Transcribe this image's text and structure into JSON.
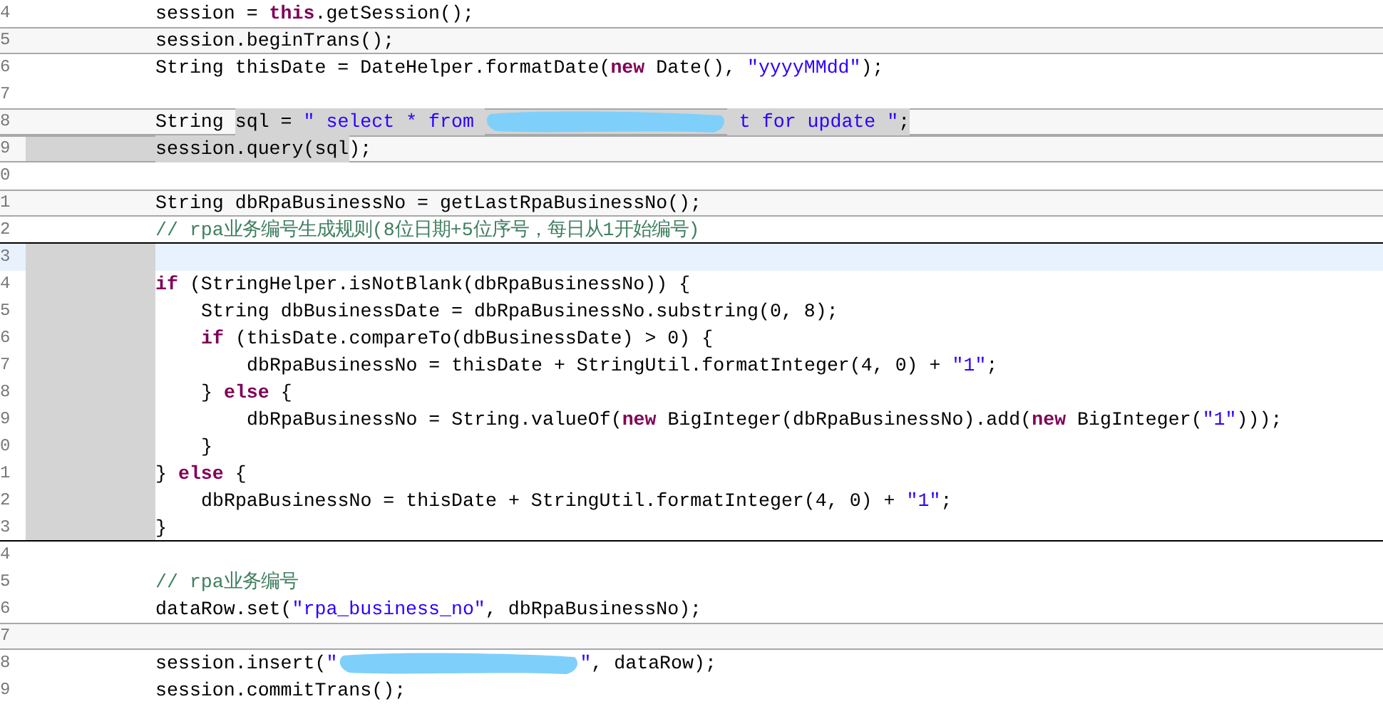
{
  "editor": {
    "lines": [
      {
        "number": "4",
        "kind": "plain",
        "tokens": [
          {
            "kind": "plain",
            "text": "session = "
          },
          {
            "kind": "keyword",
            "text": "this"
          },
          {
            "kind": "plain",
            "text": ".getSession();"
          }
        ]
      },
      {
        "number": "5",
        "kind": "framed",
        "tokens": [
          {
            "kind": "plain",
            "text": "session.beginTrans();"
          }
        ]
      },
      {
        "number": "6",
        "kind": "plain",
        "tokens": [
          {
            "kind": "plain",
            "text": "String thisDate = DateHelper.formatDate("
          },
          {
            "kind": "keyword",
            "text": "new"
          },
          {
            "kind": "plain",
            "text": " Date(), "
          },
          {
            "kind": "string",
            "text": "\"yyyyMMdd\""
          },
          {
            "kind": "plain",
            "text": ");"
          }
        ]
      },
      {
        "number": "7",
        "kind": "plain"
      },
      {
        "number": "8",
        "kind": "framed",
        "tokens": [
          {
            "kind": "plain",
            "text": "String "
          },
          {
            "kind": "plain",
            "text": "sql = ",
            "selected": true
          },
          {
            "kind": "string",
            "text": "\" select * from ",
            "selected": true
          },
          {
            "kind": "redaction",
            "selected": true
          },
          {
            "kind": "string",
            "text": " t for update \"",
            "selected": true
          },
          {
            "kind": "plain",
            "text": ";",
            "selected": true
          }
        ]
      },
      {
        "number": "9",
        "kind": "framed",
        "indent_selected": true,
        "tokens": [
          {
            "kind": "plain",
            "text": "session.query(sql",
            "selected": true
          },
          {
            "kind": "plain",
            "text": ");"
          }
        ]
      },
      {
        "number": "0",
        "kind": "plain"
      },
      {
        "number": "1",
        "kind": "framed",
        "tokens": [
          {
            "kind": "plain",
            "text": "String dbRpaBusinessNo = getLastRpaBusinessNo();"
          }
        ]
      },
      {
        "number": "2",
        "kind": "plain",
        "rule_below": true,
        "tokens": [
          {
            "kind": "comment",
            "text": "// rpa业务编号生成规则(8位日期+5位序号，每日从1开始编号)"
          }
        ]
      },
      {
        "number": "3",
        "kind": "current",
        "indent_selected": true
      },
      {
        "number": "4",
        "kind": "plain",
        "indent_selected": true,
        "tokens": [
          {
            "kind": "keyword",
            "text": "if"
          },
          {
            "kind": "plain",
            "text": " (StringHelper.isNotBlank(dbRpaBusinessNo)) {"
          }
        ]
      },
      {
        "number": "5",
        "kind": "plain",
        "indent_selected": true,
        "tokens": [
          {
            "kind": "plain",
            "text": "\tString dbBusinessDate = dbRpaBusinessNo.substring(0, 8);"
          }
        ]
      },
      {
        "number": "6",
        "kind": "plain",
        "indent_selected": true,
        "tokens": [
          {
            "kind": "keyword",
            "text": "\tif"
          },
          {
            "kind": "plain",
            "text": " (thisDate.compareTo(dbBusinessDate) > 0) {"
          }
        ]
      },
      {
        "number": "7",
        "kind": "plain",
        "indent_selected": true,
        "tokens": [
          {
            "kind": "plain",
            "text": "\t\tdbRpaBusinessNo = thisDate + StringUtil.formatInteger(4, 0) + "
          },
          {
            "kind": "string",
            "text": "\"1\""
          },
          {
            "kind": "plain",
            "text": ";"
          }
        ]
      },
      {
        "number": "8",
        "kind": "plain",
        "indent_selected": true,
        "tokens": [
          {
            "kind": "plain",
            "text": "\t} "
          },
          {
            "kind": "keyword",
            "text": "else"
          },
          {
            "kind": "plain",
            "text": " {"
          }
        ]
      },
      {
        "number": "9",
        "kind": "plain",
        "indent_selected": true,
        "tokens": [
          {
            "kind": "plain",
            "text": "\t\tdbRpaBusinessNo = String.valueOf("
          },
          {
            "kind": "keyword",
            "text": "new"
          },
          {
            "kind": "plain",
            "text": " BigInteger(dbRpaBusinessNo).add("
          },
          {
            "kind": "keyword",
            "text": "new"
          },
          {
            "kind": "plain",
            "text": " BigInteger("
          },
          {
            "kind": "string",
            "text": "\"1\""
          },
          {
            "kind": "plain",
            "text": ")));"
          }
        ]
      },
      {
        "number": "0",
        "kind": "plain",
        "indent_selected": true,
        "tokens": [
          {
            "kind": "plain",
            "text": "\t}"
          }
        ]
      },
      {
        "number": "1",
        "kind": "plain",
        "indent_selected": true,
        "tokens": [
          {
            "kind": "plain",
            "text": "} "
          },
          {
            "kind": "keyword",
            "text": "else"
          },
          {
            "kind": "plain",
            "text": " {"
          }
        ]
      },
      {
        "number": "2",
        "kind": "plain",
        "indent_selected": true,
        "tokens": [
          {
            "kind": "plain",
            "text": "\tdbRpaBusinessNo = thisDate + StringUtil.formatInteger(4, 0) + "
          },
          {
            "kind": "string",
            "text": "\"1\""
          },
          {
            "kind": "plain",
            "text": ";"
          }
        ]
      },
      {
        "number": "3",
        "kind": "plain",
        "indent_selected": true,
        "rule_below": true,
        "tokens": [
          {
            "kind": "plain",
            "text": "}"
          }
        ]
      },
      {
        "number": "4",
        "kind": "plain"
      },
      {
        "number": "5",
        "kind": "plain",
        "tokens": [
          {
            "kind": "comment",
            "text": "// rpa业务编号"
          }
        ]
      },
      {
        "number": "6",
        "kind": "plain",
        "tokens": [
          {
            "kind": "plain",
            "text": "dataRow.set("
          },
          {
            "kind": "string",
            "text": "\"rpa_business_no\""
          },
          {
            "kind": "plain",
            "text": ", dbRpaBusinessNo);"
          }
        ]
      },
      {
        "number": "7",
        "kind": "framed"
      },
      {
        "number": "8",
        "kind": "plain",
        "tokens": [
          {
            "kind": "plain",
            "text": "session.insert("
          },
          {
            "kind": "string",
            "text": "\""
          },
          {
            "kind": "redaction"
          },
          {
            "kind": "string",
            "text": "\""
          },
          {
            "kind": "plain",
            "text": ", dataRow);"
          }
        ]
      },
      {
        "number": "9",
        "kind": "plain",
        "tokens": [
          {
            "kind": "plain",
            "text": "session.commitTrans();"
          }
        ]
      }
    ]
  }
}
